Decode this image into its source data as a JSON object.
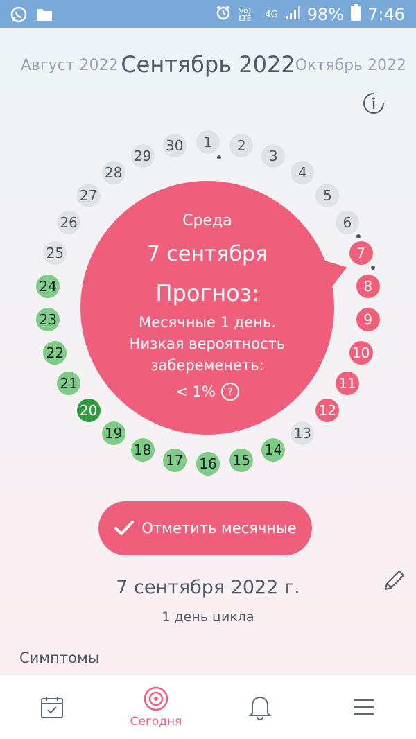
{
  "status_bar": {
    "battery": "98%",
    "time": "7:46",
    "network": "4G",
    "volte": "Vo) LTE"
  },
  "month_nav": {
    "prev": "Август 2022",
    "current": "Сентябрь 2022",
    "next": "Октябрь 2022"
  },
  "cycle_days": [
    {
      "n": "1",
      "s": "grey"
    },
    {
      "n": "2",
      "s": "grey"
    },
    {
      "n": "3",
      "s": "grey"
    },
    {
      "n": "4",
      "s": "grey"
    },
    {
      "n": "5",
      "s": "grey"
    },
    {
      "n": "6",
      "s": "grey"
    },
    {
      "n": "7",
      "s": "red"
    },
    {
      "n": "8",
      "s": "red"
    },
    {
      "n": "9",
      "s": "red"
    },
    {
      "n": "10",
      "s": "red"
    },
    {
      "n": "11",
      "s": "red"
    },
    {
      "n": "12",
      "s": "red"
    },
    {
      "n": "13",
      "s": "grey"
    },
    {
      "n": "14",
      "s": "green"
    },
    {
      "n": "15",
      "s": "green"
    },
    {
      "n": "16",
      "s": "green"
    },
    {
      "n": "17",
      "s": "green"
    },
    {
      "n": "18",
      "s": "green"
    },
    {
      "n": "19",
      "s": "green"
    },
    {
      "n": "20",
      "s": "dark"
    },
    {
      "n": "21",
      "s": "green"
    },
    {
      "n": "22",
      "s": "green"
    },
    {
      "n": "23",
      "s": "green"
    },
    {
      "n": "24",
      "s": "green"
    },
    {
      "n": "25",
      "s": "grey"
    },
    {
      "n": "26",
      "s": "grey"
    },
    {
      "n": "27",
      "s": "grey"
    },
    {
      "n": "28",
      "s": "grey"
    },
    {
      "n": "29",
      "s": "grey"
    },
    {
      "n": "30",
      "s": "grey"
    }
  ],
  "bubble": {
    "weekday": "Среда",
    "date": "7 сентября",
    "heading": "Прогноз:",
    "line1": "Месячные 1 день.",
    "line2": "Низкая вероятность",
    "line3": "забеременеть:",
    "probability": "< 1%",
    "help_glyph": "?"
  },
  "actions": {
    "mark_period": "Отметить месячные"
  },
  "selected": {
    "date": "7 сентября 2022 г.",
    "cycle_day": "1 день цикла"
  },
  "sections": {
    "symptoms": "Симптомы"
  },
  "bottom_nav": {
    "today": "Сегодня"
  },
  "colors": {
    "accent": "#ef5f7b",
    "fertile": "#7fcc86",
    "ovulation": "#2e9b3f",
    "neutral": "#dfe3e6"
  }
}
